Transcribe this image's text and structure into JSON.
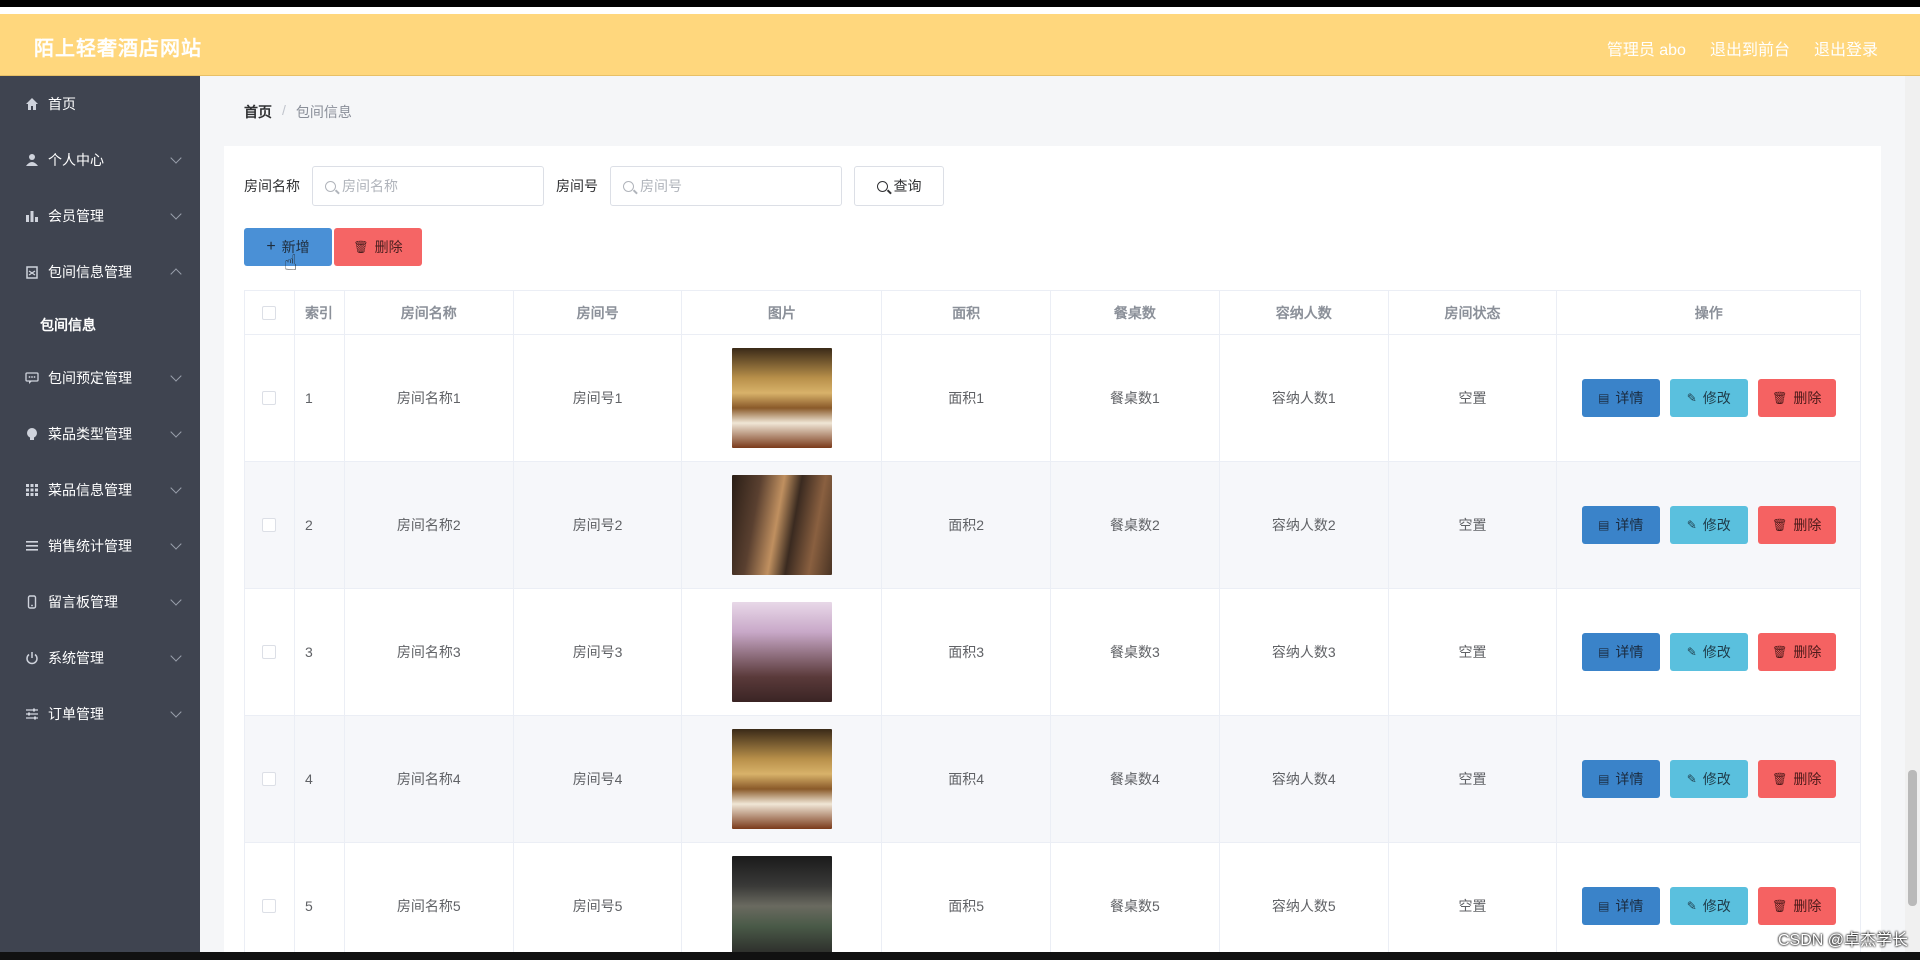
{
  "header": {
    "title": "陌上轻奢酒店网站",
    "nav": [
      "管理员 abo",
      "退出到前台",
      "退出登录"
    ],
    "bg_color": "#ffd77d"
  },
  "sidebar": {
    "items": [
      {
        "label": "首页",
        "icon": "home-icon"
      },
      {
        "label": "个人中心",
        "icon": "user-icon"
      },
      {
        "label": "会员管理",
        "icon": "bar-chart-icon"
      },
      {
        "label": "包间信息管理",
        "icon": "clipboard-icon"
      },
      {
        "label": "包间预定管理",
        "icon": "chat-icon"
      },
      {
        "label": "菜品类型管理",
        "icon": "lightbulb-icon"
      },
      {
        "label": "菜品信息管理",
        "icon": "grid-icon"
      },
      {
        "label": "销售统计管理",
        "icon": "list-icon"
      },
      {
        "label": "留言板管理",
        "icon": "phone-icon"
      },
      {
        "label": "系统管理",
        "icon": "power-icon"
      },
      {
        "label": "订单管理",
        "icon": "sliders-icon"
      }
    ],
    "submenu": {
      "label": "包间信息"
    }
  },
  "breadcrumb": {
    "home": "首页",
    "separator": "/",
    "current": "包间信息"
  },
  "filters": {
    "name_label": "房间名称",
    "name_placeholder": "房间名称",
    "no_label": "房间号",
    "no_placeholder": "房间号",
    "query_label": "查询"
  },
  "actions": {
    "add_label": "新增",
    "delete_label": "删除"
  },
  "table": {
    "headers": [
      "索引",
      "房间名称",
      "房间号",
      "图片",
      "面积",
      "餐桌数",
      "容纳人数",
      "房间状态",
      "操作"
    ],
    "rows": [
      {
        "index": "1",
        "name": "房间名称1",
        "no": "房间号1",
        "area": "面积1",
        "tables": "餐桌数1",
        "capacity": "容纳人数1",
        "status": "空置"
      },
      {
        "index": "2",
        "name": "房间名称2",
        "no": "房间号2",
        "area": "面积2",
        "tables": "餐桌数2",
        "capacity": "容纳人数2",
        "status": "空置"
      },
      {
        "index": "3",
        "name": "房间名称3",
        "no": "房间号3",
        "area": "面积3",
        "tables": "餐桌数3",
        "capacity": "容纳人数3",
        "status": "空置"
      },
      {
        "index": "4",
        "name": "房间名称4",
        "no": "房间号4",
        "area": "面积4",
        "tables": "餐桌数4",
        "capacity": "容纳人数4",
        "status": "空置"
      },
      {
        "index": "5",
        "name": "房间名称5",
        "no": "房间号5",
        "area": "面积5",
        "tables": "餐桌数5",
        "capacity": "容纳人数5",
        "status": "空置"
      }
    ],
    "op_labels": {
      "detail": "详情",
      "edit": "修改",
      "delete": "删除"
    }
  },
  "watermark": "CSDN @卓杰学长"
}
